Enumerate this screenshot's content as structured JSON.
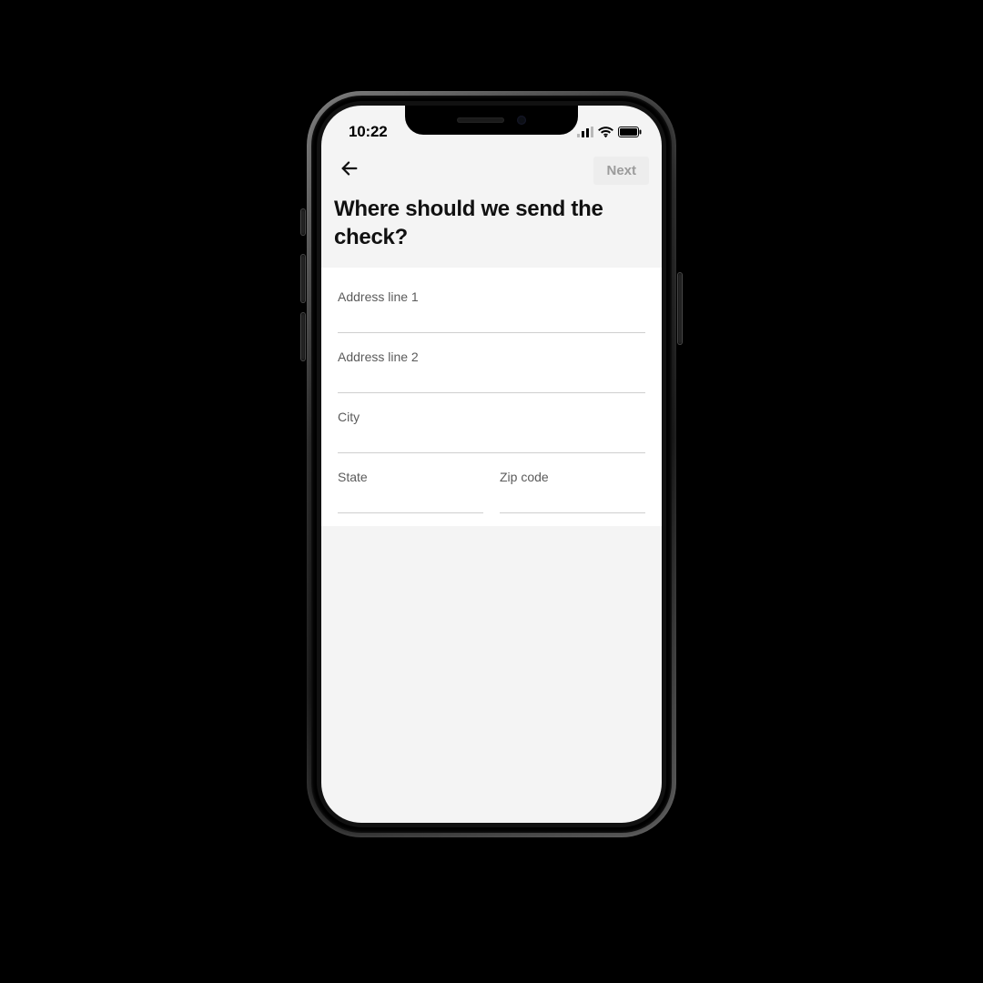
{
  "statusbar": {
    "time": "10:22"
  },
  "header": {
    "next_label": "Next",
    "title": "Where should we send the check?"
  },
  "form": {
    "address1": {
      "label": "Address line 1",
      "value": ""
    },
    "address2": {
      "label": "Address line 2",
      "value": ""
    },
    "city": {
      "label": "City",
      "value": ""
    },
    "state": {
      "label": "State",
      "value": ""
    },
    "zip": {
      "label": "Zip code",
      "value": ""
    }
  }
}
